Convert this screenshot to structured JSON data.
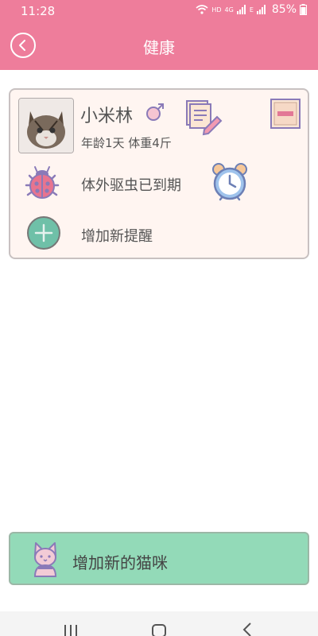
{
  "status_bar": {
    "time": "11:28",
    "hd_label": "HD",
    "network_label": "4G",
    "network2_label": "E",
    "battery": "85%"
  },
  "header": {
    "title": "健康"
  },
  "pet": {
    "name": "小米林",
    "info": "年龄1天  体重4斤",
    "reminder": "体外驱虫已到期",
    "add_reminder": "增加新提醒"
  },
  "footer": {
    "add_cat": "增加新的猫咪"
  },
  "colors": {
    "header": "#ee7d9b",
    "card_bg": "#fff5f1",
    "add_button": "#93dab8"
  },
  "icons": [
    "back-icon",
    "gender-icon",
    "edit-icon",
    "delete-icon",
    "bug-icon",
    "alarm-clock-icon",
    "plus-circle-icon",
    "cat-icon"
  ]
}
